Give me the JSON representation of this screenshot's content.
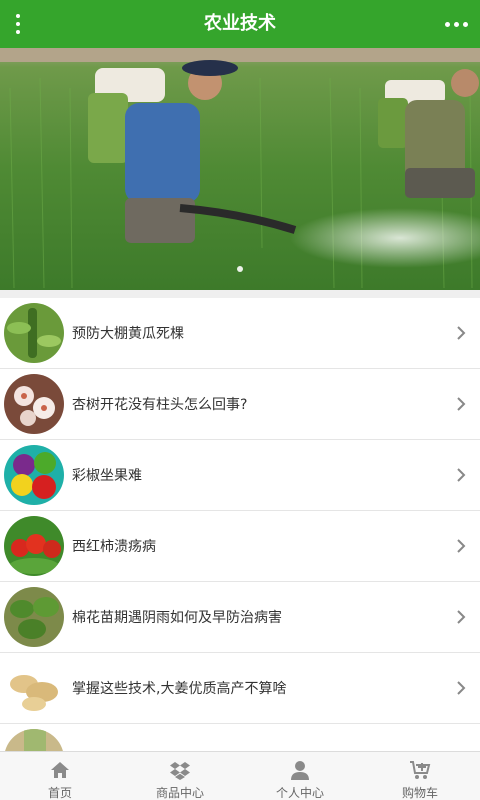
{
  "header": {
    "title": "农业技术"
  },
  "banner": {
    "image": "farmers-spraying-field-photo",
    "slide_count": 1
  },
  "articles": [
    {
      "title": "预防大棚黄瓜死棵",
      "thumb": "cucumber-plant-thumb"
    },
    {
      "title": "杏树开花没有柱头怎么回事?",
      "thumb": "apricot-blossom-thumb"
    },
    {
      "title": "彩椒坐果难",
      "thumb": "bell-pepper-thumb"
    },
    {
      "title": "西红柿溃疡病",
      "thumb": "tomato-thumb"
    },
    {
      "title": "棉花苗期遇阴雨如何及早防治病害",
      "thumb": "cotton-seedling-thumb"
    },
    {
      "title": "掌握这些技术,大姜优质高产不算啥",
      "thumb": "ginger-thumb"
    },
    {
      "title": "",
      "thumb": "partial-thumb"
    }
  ],
  "tabs": [
    {
      "label": "首页",
      "icon": "home-icon"
    },
    {
      "label": "商品中心",
      "icon": "dropbox-icon"
    },
    {
      "label": "个人中心",
      "icon": "user-icon"
    },
    {
      "label": "购物车",
      "icon": "cart-icon"
    }
  ],
  "colors": {
    "primary": "#35a52c",
    "text": "#333333",
    "tab_text": "#666666"
  }
}
